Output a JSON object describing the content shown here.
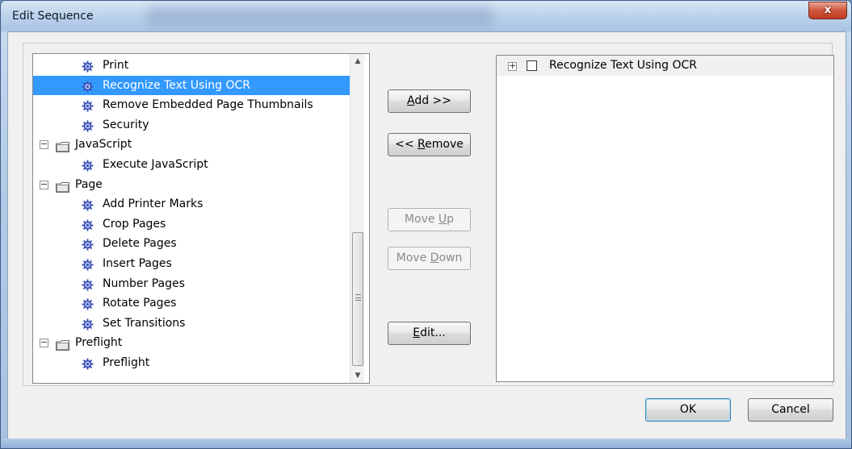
{
  "window": {
    "title": "Edit Sequence",
    "close_label": "x"
  },
  "tree": {
    "rows": [
      {
        "kind": "item",
        "label": "Print",
        "selected": false
      },
      {
        "kind": "item",
        "label": "Recognize Text Using OCR",
        "selected": true
      },
      {
        "kind": "item",
        "label": "Remove Embedded Page Thumbnails",
        "selected": false
      },
      {
        "kind": "item",
        "label": "Security",
        "selected": false
      },
      {
        "kind": "folder",
        "label": "JavaScript",
        "expander": "−"
      },
      {
        "kind": "item",
        "label": "Execute JavaScript",
        "selected": false
      },
      {
        "kind": "folder",
        "label": "Page",
        "expander": "−"
      },
      {
        "kind": "item",
        "label": "Add Printer Marks",
        "selected": false
      },
      {
        "kind": "item",
        "label": "Crop Pages",
        "selected": false
      },
      {
        "kind": "item",
        "label": "Delete Pages",
        "selected": false
      },
      {
        "kind": "item",
        "label": "Insert Pages",
        "selected": false
      },
      {
        "kind": "item",
        "label": "Number Pages",
        "selected": false
      },
      {
        "kind": "item",
        "label": "Rotate Pages",
        "selected": false
      },
      {
        "kind": "item",
        "label": "Set Transitions",
        "selected": false
      },
      {
        "kind": "folder",
        "label": "Preflight",
        "expander": "−"
      },
      {
        "kind": "item",
        "label": "Preflight",
        "selected": false
      }
    ],
    "scroll_up_glyph": "▲",
    "scroll_down_glyph": "▼"
  },
  "buttons": {
    "add": {
      "pre": "",
      "accel": "A",
      "post": "dd >>"
    },
    "remove": {
      "pre": "<< ",
      "accel": "R",
      "post": "emove"
    },
    "move_up": {
      "pre": "Move ",
      "accel": "U",
      "post": "p"
    },
    "move_down": {
      "pre": "Move ",
      "accel": "D",
      "post": "own"
    },
    "edit": {
      "pre": "",
      "accel": "E",
      "post": "dit..."
    },
    "ok": "OK",
    "cancel": "Cancel"
  },
  "sequence": {
    "items": [
      {
        "label": "Recognize Text Using OCR",
        "expander": "+",
        "checked": false
      }
    ]
  },
  "colors": {
    "selection": "#3399ff",
    "folder": "#f4d46c",
    "gear": "#3a4fb4"
  }
}
